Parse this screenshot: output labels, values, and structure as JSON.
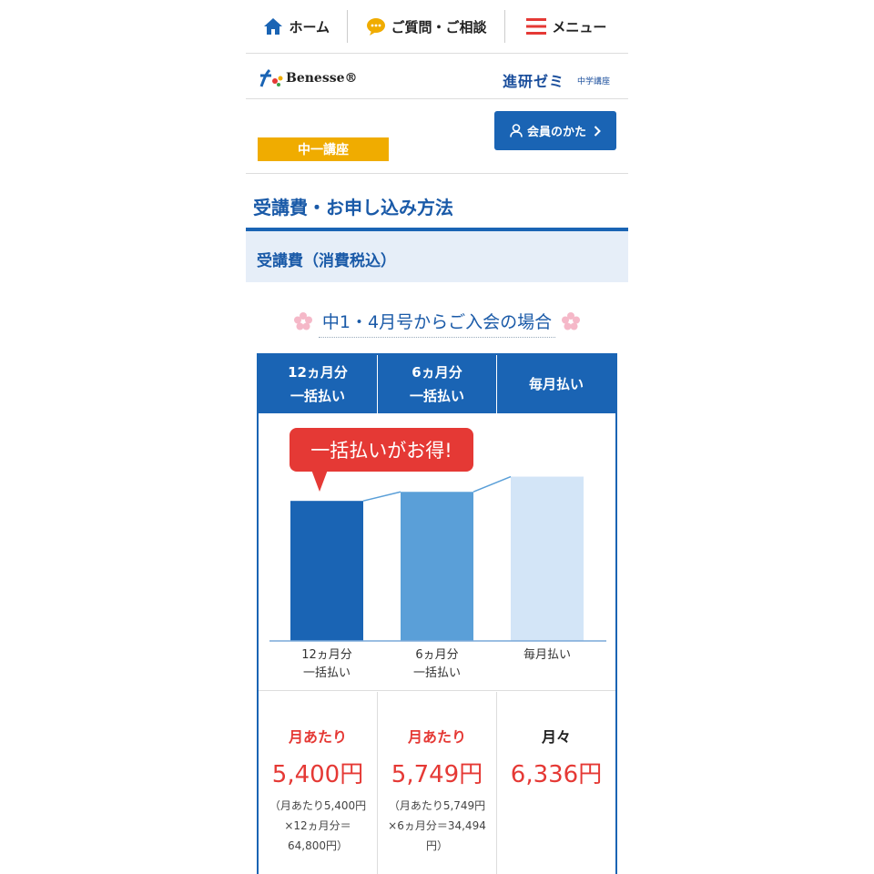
{
  "nav": {
    "home": "ホーム",
    "faq": "ご質問・ご相談",
    "menu": "メニュー"
  },
  "brand": {
    "benesse": "Benesse®",
    "zemi": "進研ゼミ",
    "zemi_sub": "中学講座"
  },
  "course": {
    "tag": "中一講座",
    "member_button": "会員のかた"
  },
  "page": {
    "title": "受講費・お申し込み方法",
    "section": "受講費（消費税込）",
    "case_heading": "中1・4月号からご入会の場合"
  },
  "plans": {
    "headers": [
      {
        "line1": "12ヵ月分",
        "line2": "一括払い"
      },
      {
        "line1": "6ヵ月分",
        "line2": "一括払い"
      },
      {
        "line1": "毎月払い",
        "line2": ""
      }
    ],
    "bubble": "一括払いがお得!",
    "prices": [
      {
        "label": "月あたり",
        "value": "5,400円",
        "note": "（月あたり5,400円×12ヵ月分＝64,800円）"
      },
      {
        "label": "月あたり",
        "value": "5,749円",
        "note": "（月あたり5,749円×6ヵ月分＝34,494円）"
      },
      {
        "label": "月々",
        "value": "6,336円",
        "note": ""
      }
    ]
  },
  "chart_data": {
    "type": "bar",
    "categories": [
      "12ヵ月分 一括払い",
      "6ヵ月分 一括払い",
      "毎月払い"
    ],
    "category_lines": [
      [
        "12ヵ月分",
        "一括払い"
      ],
      [
        "6ヵ月分",
        "一括払い"
      ],
      [
        "毎月払い"
      ]
    ],
    "values": [
      5400,
      5749,
      6336
    ],
    "colors": [
      "#1a64b4",
      "#5a9fd8",
      "#d3e5f7"
    ],
    "title": "",
    "xlabel": "",
    "ylabel": "",
    "ylim": [
      0,
      6600
    ],
    "grid": false,
    "legend": "none"
  },
  "colors": {
    "primary": "#1a64b4",
    "accent_red": "#e53935",
    "tag_yellow": "#f0ac00",
    "band": "#e6eef8"
  },
  "icons": {
    "home": "home-icon",
    "faq": "speech-bubble-icon",
    "menu": "hamburger-icon",
    "member": "user-icon",
    "flower": "sakura-icon"
  }
}
